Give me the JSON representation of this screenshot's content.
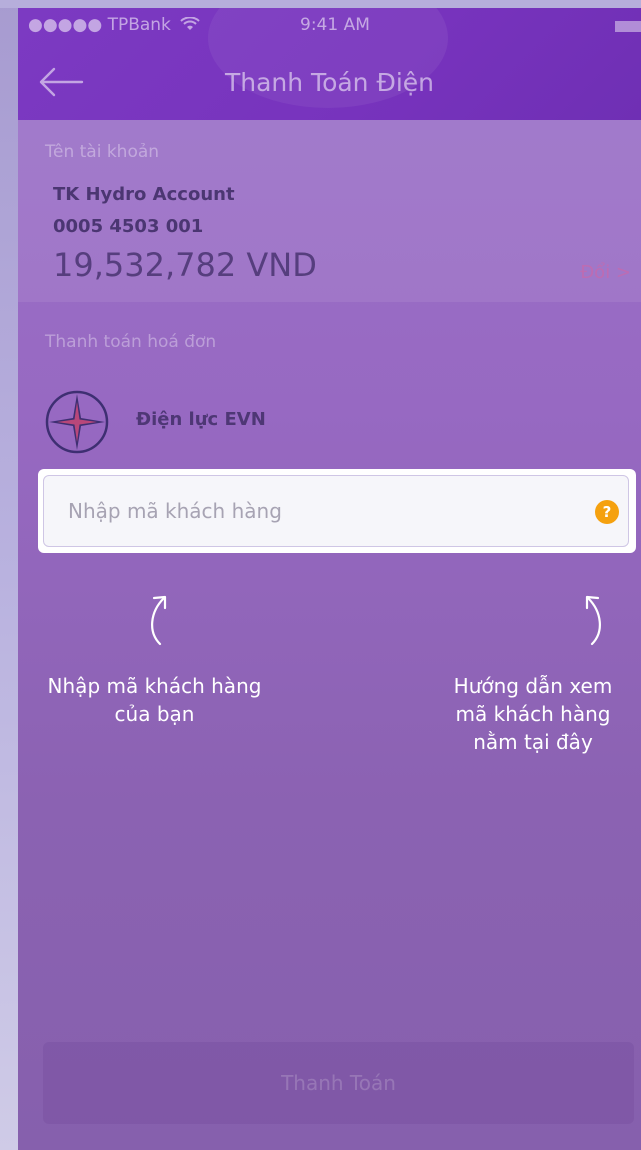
{
  "status_bar": {
    "carrier": "●●●●● TPBank",
    "time": "9:41 AM"
  },
  "header": {
    "title": "Thanh Toán Điện"
  },
  "account": {
    "label": "Tên tài khoản",
    "name": "TK Hydro Account",
    "number": "0005 4503 001",
    "balance": "19,532,782 VND",
    "change_label": "Đổi >"
  },
  "bill": {
    "section_label": "Thanh toán hoá đơn",
    "provider_name": "Điện lực EVN"
  },
  "customer_input": {
    "placeholder": "Nhập mã khách hàng",
    "value": "",
    "help_label": "?"
  },
  "coach_marks": {
    "left_line1": "Nhập mã khách hàng",
    "left_line2": "của bạn",
    "right_line1": "Hướng dẫn xem",
    "right_line2": "mã khách hàng",
    "right_line3": "nằm tại đây"
  },
  "footer": {
    "pay_label": "Thanh Toán"
  },
  "colors": {
    "header_bg": "#7733bd",
    "body_bg": "#9769c2",
    "help_badge": "#f5a10f",
    "change_link": "#d664a0"
  },
  "icons": {
    "back": "arrow-left-icon",
    "wifi": "wifi-icon",
    "battery": "battery-icon",
    "help": "question-icon",
    "evn": "evn-star-logo"
  }
}
